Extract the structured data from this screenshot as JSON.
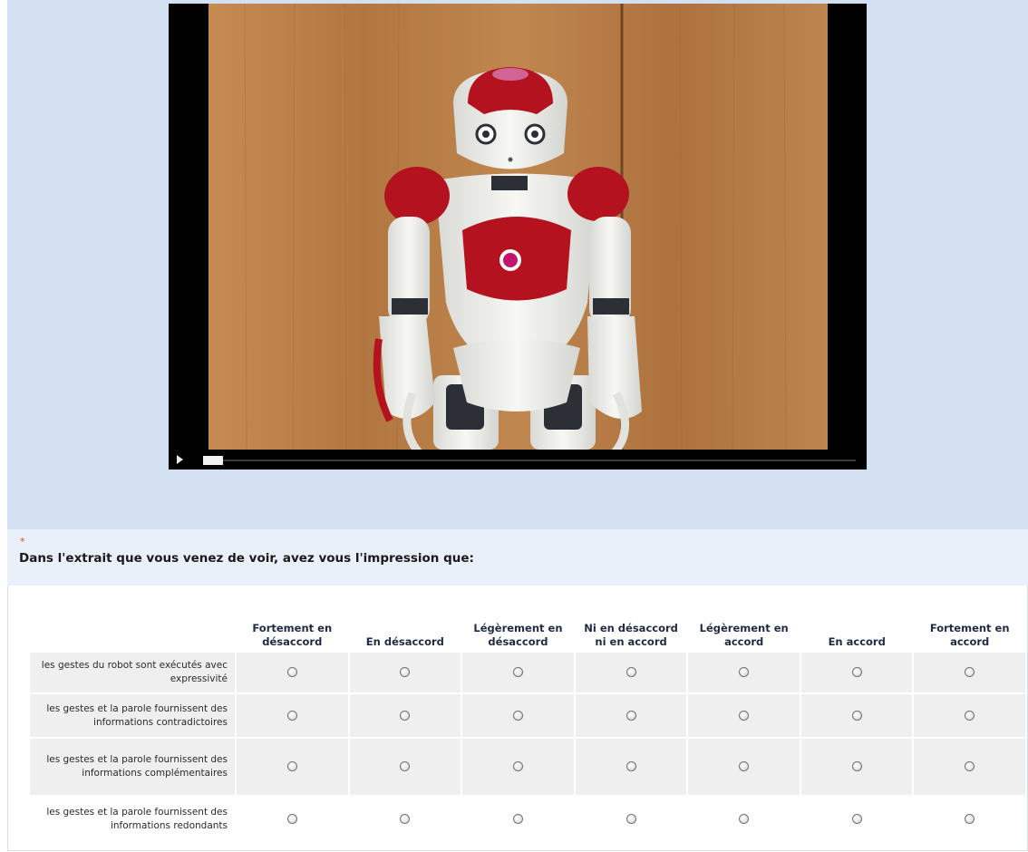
{
  "question": {
    "required_marker": "*",
    "title": "Dans l'extrait que vous venez de voir, avez vous l'impression que:"
  },
  "video": {
    "state": "paused",
    "progress": 0.0
  },
  "matrix": {
    "columns": [
      "Fortement en désaccord",
      "En désaccord",
      "Légèrement en désaccord",
      "Ni en désaccord ni en accord",
      "Légèrement en accord",
      "En accord",
      "Fortement en accord"
    ],
    "rows": [
      "les gestes du robot sont exécutés avec expressivité",
      "les gestes et la parole fournissent des informations contradictoires",
      "les gestes et la parole fournissent des informations complémentaires",
      "les gestes et la parole fournissent des informations redondants"
    ]
  },
  "colors": {
    "top_band": "#d3e0f1",
    "question_band": "#e9f0f9",
    "row_bg": "#efefef",
    "required": "#e0452e",
    "robot_red": "#b3121e",
    "wood": "#b67d45"
  }
}
